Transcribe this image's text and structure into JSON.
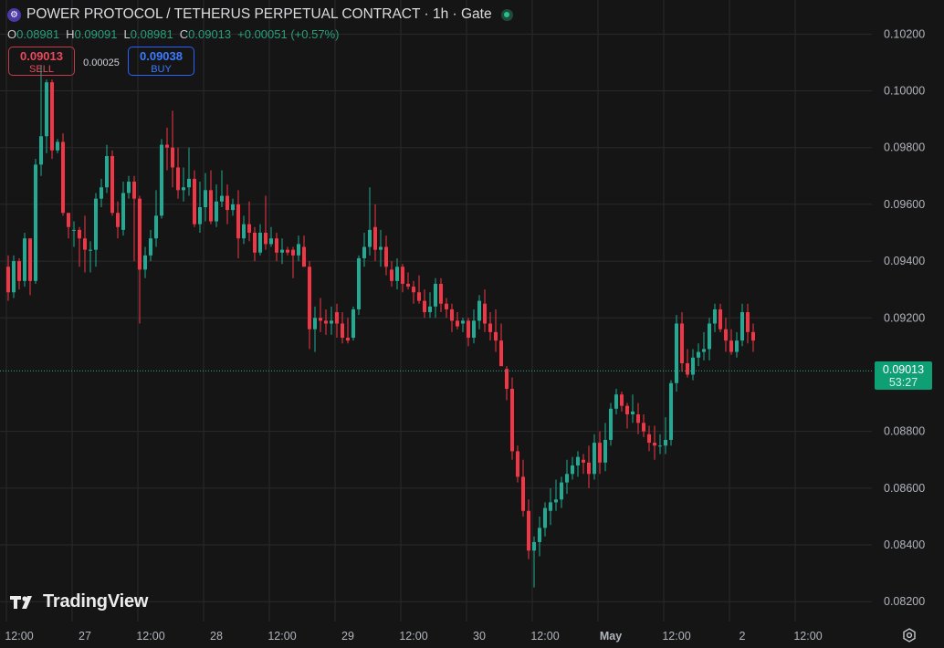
{
  "header": {
    "title": "POWER PROTOCOL / TETHERUS PERPETUAL CONTRACT · 1h · Gate",
    "icon": "power-protocol-logo-icon",
    "status_color": "#26c28e"
  },
  "ohlc": {
    "o_label": "O",
    "o": "0.08981",
    "h_label": "H",
    "h": "0.09091",
    "l_label": "L",
    "l": "0.08981",
    "c_label": "C",
    "c": "0.09013",
    "change": "+0.00051 (+0.57%)"
  },
  "trade": {
    "sell_price": "0.09013",
    "sell_label": "SELL",
    "spread": "0.00025",
    "buy_price": "0.09038",
    "buy_label": "BUY"
  },
  "last_price": {
    "price": "0.09013",
    "countdown": "53:27"
  },
  "watermark": "TradingView",
  "colors": {
    "up": "#22ab94",
    "down": "#f23645",
    "background": "#151515",
    "grid": "#2a2a2a"
  },
  "chart_data": {
    "type": "candlestick",
    "ylim": [
      0.0813,
      0.1032
    ],
    "yticks": [
      "0.10200",
      "0.10000",
      "0.09800",
      "0.09600",
      "0.09400",
      "0.09200",
      "0.08800",
      "0.08600",
      "0.08400",
      "0.08200"
    ],
    "xticks": [
      {
        "label": "12:00",
        "index": 0
      },
      {
        "label": "27",
        "index": 12
      },
      {
        "label": "12:00",
        "index": 24
      },
      {
        "label": "28",
        "index": 36
      },
      {
        "label": "12:00",
        "index": 48
      },
      {
        "label": "29",
        "index": 60
      },
      {
        "label": "12:00",
        "index": 72
      },
      {
        "label": "30",
        "index": 84
      },
      {
        "label": "12:00",
        "index": 96
      },
      {
        "label": "May",
        "index": 108,
        "bold": true
      },
      {
        "label": "12:00",
        "index": 120
      },
      {
        "label": "2",
        "index": 132
      },
      {
        "label": "12:00",
        "index": 144
      }
    ],
    "candles": [
      [
        0.0938,
        0.0942,
        0.0926,
        0.0929
      ],
      [
        0.0929,
        0.0942,
        0.0927,
        0.094
      ],
      [
        0.094,
        0.0941,
        0.093,
        0.0933
      ],
      [
        0.0933,
        0.095,
        0.0931,
        0.0948
      ],
      [
        0.0948,
        0.0936,
        0.0928,
        0.0933
      ],
      [
        0.0933,
        0.0976,
        0.0932,
        0.0974
      ],
      [
        0.0974,
        0.1009,
        0.097,
        0.0984
      ],
      [
        0.0984,
        0.1004,
        0.0978,
        0.1003
      ],
      [
        0.1003,
        0.1004,
        0.0976,
        0.0979
      ],
      [
        0.0979,
        0.0983,
        0.0978,
        0.0982
      ],
      [
        0.0982,
        0.0985,
        0.0956,
        0.0957
      ],
      [
        0.0957,
        0.0956,
        0.0948,
        0.0952
      ],
      [
        0.0951,
        0.0954,
        0.0945,
        0.0951
      ],
      [
        0.0951,
        0.0952,
        0.0938,
        0.0948
      ],
      [
        0.0948,
        0.0956,
        0.0936,
        0.0944
      ],
      [
        0.0944,
        0.0947,
        0.0936,
        0.0944
      ],
      [
        0.0944,
        0.0964,
        0.0938,
        0.0962
      ],
      [
        0.0962,
        0.0969,
        0.0959,
        0.0966
      ],
      [
        0.0966,
        0.0981,
        0.0964,
        0.0977
      ],
      [
        0.0977,
        0.0979,
        0.0956,
        0.0957
      ],
      [
        0.0957,
        0.0961,
        0.0948,
        0.0952
      ],
      [
        0.0951,
        0.0968,
        0.0949,
        0.0964
      ],
      [
        0.0964,
        0.097,
        0.0962,
        0.0968
      ],
      [
        0.0968,
        0.097,
        0.094,
        0.0962
      ],
      [
        0.0962,
        0.0963,
        0.0918,
        0.0937
      ],
      [
        0.0937,
        0.0945,
        0.0934,
        0.0942
      ],
      [
        0.0942,
        0.0951,
        0.094,
        0.0948
      ],
      [
        0.0948,
        0.0965,
        0.0945,
        0.0956
      ],
      [
        0.0956,
        0.0983,
        0.0955,
        0.0981
      ],
      [
        0.0981,
        0.0987,
        0.0972,
        0.098
      ],
      [
        0.098,
        0.0993,
        0.0966,
        0.0973
      ],
      [
        0.0973,
        0.098,
        0.0962,
        0.0965
      ],
      [
        0.0965,
        0.0973,
        0.0961,
        0.0966
      ],
      [
        0.0966,
        0.098,
        0.0963,
        0.0969
      ],
      [
        0.0969,
        0.0972,
        0.0952,
        0.0953
      ],
      [
        0.0953,
        0.0968,
        0.095,
        0.0959
      ],
      [
        0.0959,
        0.0971,
        0.0954,
        0.0965
      ],
      [
        0.0965,
        0.0972,
        0.0953,
        0.0954
      ],
      [
        0.0954,
        0.0967,
        0.0952,
        0.0961
      ],
      [
        0.0961,
        0.0972,
        0.0959,
        0.0963
      ],
      [
        0.0963,
        0.0967,
        0.0953,
        0.0958
      ],
      [
        0.0958,
        0.0962,
        0.0956,
        0.096
      ],
      [
        0.096,
        0.0965,
        0.0941,
        0.0948
      ],
      [
        0.0948,
        0.0956,
        0.0946,
        0.0953
      ],
      [
        0.0953,
        0.0961,
        0.0947,
        0.095
      ],
      [
        0.095,
        0.0952,
        0.094,
        0.0943
      ],
      [
        0.0943,
        0.0953,
        0.0942,
        0.095
      ],
      [
        0.095,
        0.0963,
        0.0944,
        0.0946
      ],
      [
        0.0946,
        0.0952,
        0.0945,
        0.0948
      ],
      [
        0.0948,
        0.095,
        0.094,
        0.0943
      ],
      [
        0.0943,
        0.0948,
        0.0939,
        0.0944
      ],
      [
        0.0944,
        0.0945,
        0.0942,
        0.0943
      ],
      [
        0.0944,
        0.0945,
        0.0934,
        0.0942
      ],
      [
        0.0942,
        0.0949,
        0.094,
        0.0946
      ],
      [
        0.0945,
        0.0949,
        0.0942,
        0.0938
      ],
      [
        0.0938,
        0.094,
        0.0909,
        0.0916
      ],
      [
        0.0916,
        0.0924,
        0.0908,
        0.092
      ],
      [
        0.092,
        0.0927,
        0.0915,
        0.0919
      ],
      [
        0.0919,
        0.0923,
        0.0914,
        0.0918
      ],
      [
        0.0918,
        0.0924,
        0.0914,
        0.0919
      ],
      [
        0.0922,
        0.0925,
        0.0913,
        0.0918
      ],
      [
        0.0918,
        0.0922,
        0.0911,
        0.0913
      ],
      [
        0.0913,
        0.092,
        0.0911,
        0.0912
      ],
      [
        0.0913,
        0.0924,
        0.0912,
        0.0923
      ],
      [
        0.0923,
        0.0942,
        0.0921,
        0.0941
      ],
      [
        0.0941,
        0.095,
        0.0938,
        0.0945
      ],
      [
        0.0945,
        0.0966,
        0.0942,
        0.0951
      ],
      [
        0.0952,
        0.096,
        0.094,
        0.0944
      ],
      [
        0.0944,
        0.0951,
        0.0938,
        0.0945
      ],
      [
        0.0945,
        0.0949,
        0.0935,
        0.0938
      ],
      [
        0.0937,
        0.094,
        0.0931,
        0.0933
      ],
      [
        0.0933,
        0.0941,
        0.093,
        0.0938
      ],
      [
        0.0938,
        0.0939,
        0.0929,
        0.0932
      ],
      [
        0.0932,
        0.0936,
        0.093,
        0.0931
      ],
      [
        0.0931,
        0.0933,
        0.0925,
        0.0929
      ],
      [
        0.0929,
        0.0935,
        0.0925,
        0.0926
      ],
      [
        0.0926,
        0.093,
        0.092,
        0.0922
      ],
      [
        0.0922,
        0.0929,
        0.092,
        0.0924
      ],
      [
        0.0924,
        0.0934,
        0.092,
        0.0932
      ],
      [
        0.0932,
        0.0934,
        0.0922,
        0.0925
      ],
      [
        0.0925,
        0.0927,
        0.092,
        0.0923
      ],
      [
        0.0923,
        0.0925,
        0.0915,
        0.0919
      ],
      [
        0.0919,
        0.0922,
        0.0916,
        0.0917
      ],
      [
        0.0918,
        0.092,
        0.0915,
        0.0919
      ],
      [
        0.0919,
        0.092,
        0.091,
        0.0913
      ],
      [
        0.0913,
        0.0923,
        0.0911,
        0.0919
      ],
      [
        0.0919,
        0.0928,
        0.0916,
        0.0926
      ],
      [
        0.0925,
        0.093,
        0.0915,
        0.0918
      ],
      [
        0.0918,
        0.0922,
        0.0912,
        0.0915
      ],
      [
        0.0915,
        0.0923,
        0.0908,
        0.0912
      ],
      [
        0.0912,
        0.0918,
        0.0903,
        0.0903
      ],
      [
        0.0902,
        0.0903,
        0.0891,
        0.0895
      ],
      [
        0.0895,
        0.0899,
        0.087,
        0.0873
      ],
      [
        0.0873,
        0.0875,
        0.0862,
        0.0864
      ],
      [
        0.0864,
        0.087,
        0.085,
        0.0852
      ],
      [
        0.0852,
        0.0856,
        0.0835,
        0.0838
      ],
      [
        0.0838,
        0.0843,
        0.0825,
        0.0841
      ],
      [
        0.0841,
        0.085,
        0.0836,
        0.0846
      ],
      [
        0.0846,
        0.0855,
        0.0843,
        0.0853
      ],
      [
        0.0852,
        0.086,
        0.0847,
        0.0855
      ],
      [
        0.0855,
        0.0863,
        0.0852,
        0.0856
      ],
      [
        0.0856,
        0.0864,
        0.0853,
        0.0862
      ],
      [
        0.0862,
        0.087,
        0.0858,
        0.0865
      ],
      [
        0.0865,
        0.0871,
        0.0863,
        0.0868
      ],
      [
        0.0868,
        0.0873,
        0.0864,
        0.0871
      ],
      [
        0.087,
        0.0872,
        0.0865,
        0.0869
      ],
      [
        0.0869,
        0.0875,
        0.086,
        0.0865
      ],
      [
        0.0865,
        0.0879,
        0.0863,
        0.0876
      ],
      [
        0.0876,
        0.088,
        0.0865,
        0.0869
      ],
      [
        0.0869,
        0.0883,
        0.0866,
        0.0877
      ],
      [
        0.0877,
        0.089,
        0.0875,
        0.0888
      ],
      [
        0.0888,
        0.0895,
        0.0886,
        0.0893
      ],
      [
        0.0893,
        0.0894,
        0.0887,
        0.0889
      ],
      [
        0.0889,
        0.089,
        0.0881,
        0.0886
      ],
      [
        0.0886,
        0.0893,
        0.0883,
        0.0887
      ],
      [
        0.0886,
        0.089,
        0.0879,
        0.0883
      ],
      [
        0.0883,
        0.0886,
        0.0878,
        0.088
      ],
      [
        0.0879,
        0.0882,
        0.0873,
        0.0876
      ],
      [
        0.0876,
        0.0882,
        0.087,
        0.0875
      ],
      [
        0.0875,
        0.0879,
        0.0872,
        0.0875
      ],
      [
        0.0875,
        0.0885,
        0.0872,
        0.0877
      ],
      [
        0.0877,
        0.0898,
        0.0875,
        0.0897
      ],
      [
        0.0897,
        0.0921,
        0.0894,
        0.0918
      ],
      [
        0.0918,
        0.0922,
        0.0901,
        0.0904
      ],
      [
        0.0904,
        0.0909,
        0.0899,
        0.09
      ],
      [
        0.09,
        0.0909,
        0.0898,
        0.0906
      ],
      [
        0.0906,
        0.0911,
        0.0903,
        0.0908
      ],
      [
        0.0908,
        0.0915,
        0.0905,
        0.0909
      ],
      [
        0.0909,
        0.092,
        0.0905,
        0.0918
      ],
      [
        0.0918,
        0.0925,
        0.0915,
        0.0923
      ],
      [
        0.0923,
        0.0925,
        0.0915,
        0.0916
      ],
      [
        0.0916,
        0.092,
        0.0908,
        0.0912
      ],
      [
        0.0912,
        0.0916,
        0.0907,
        0.0908
      ],
      [
        0.0908,
        0.0915,
        0.0906,
        0.0912
      ],
      [
        0.0912,
        0.0925,
        0.091,
        0.0922
      ],
      [
        0.0922,
        0.0925,
        0.0911,
        0.0915
      ],
      [
        0.0915,
        0.0918,
        0.0908,
        0.0912
      ]
    ]
  }
}
